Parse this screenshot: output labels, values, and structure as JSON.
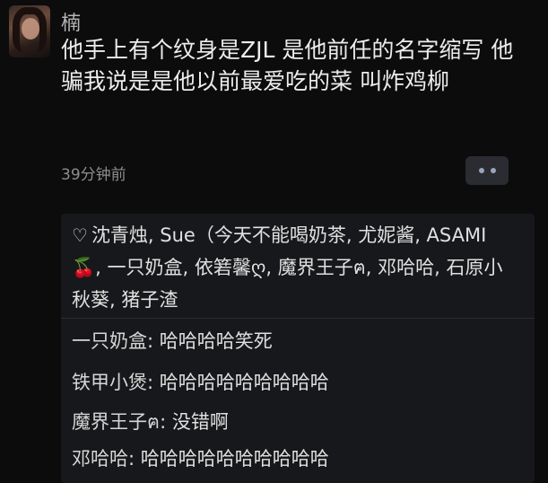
{
  "comment": {
    "username": "楠",
    "text": "他手上有个纹身是ZJL 是他前任的名字缩写 他骗我说是是他以前最爱吃的菜 叫炸鸡柳",
    "time": "39分钟前"
  },
  "likes": {
    "text": "沈青烛, Sue（今天不能喝奶茶, 尤妮酱, ASAMI🍒, 一只奶盒, 依箬馨ღ, 魔界王子ฅ, 邓哈哈, 石原小秋葵, 猪子渣"
  },
  "replies": [
    {
      "author": "一只奶盒",
      "text": "哈哈哈哈笑死"
    },
    {
      "author": "铁甲小煲",
      "text": "哈哈哈哈哈哈哈哈哈"
    },
    {
      "author": "魔界王子ฅ",
      "text": "没错啊"
    },
    {
      "author": "邓哈哈",
      "text": "哈哈哈哈哈哈哈哈哈哈"
    }
  ],
  "colors": {
    "background": "#0c0c0c",
    "reply_panel": "#17181b",
    "text_primary": "#ececec",
    "text_secondary": "#8d8d8d",
    "more_button": "#2a2c31"
  },
  "icons": [
    "avatar",
    "more-dots-icon",
    "heart-icon"
  ]
}
